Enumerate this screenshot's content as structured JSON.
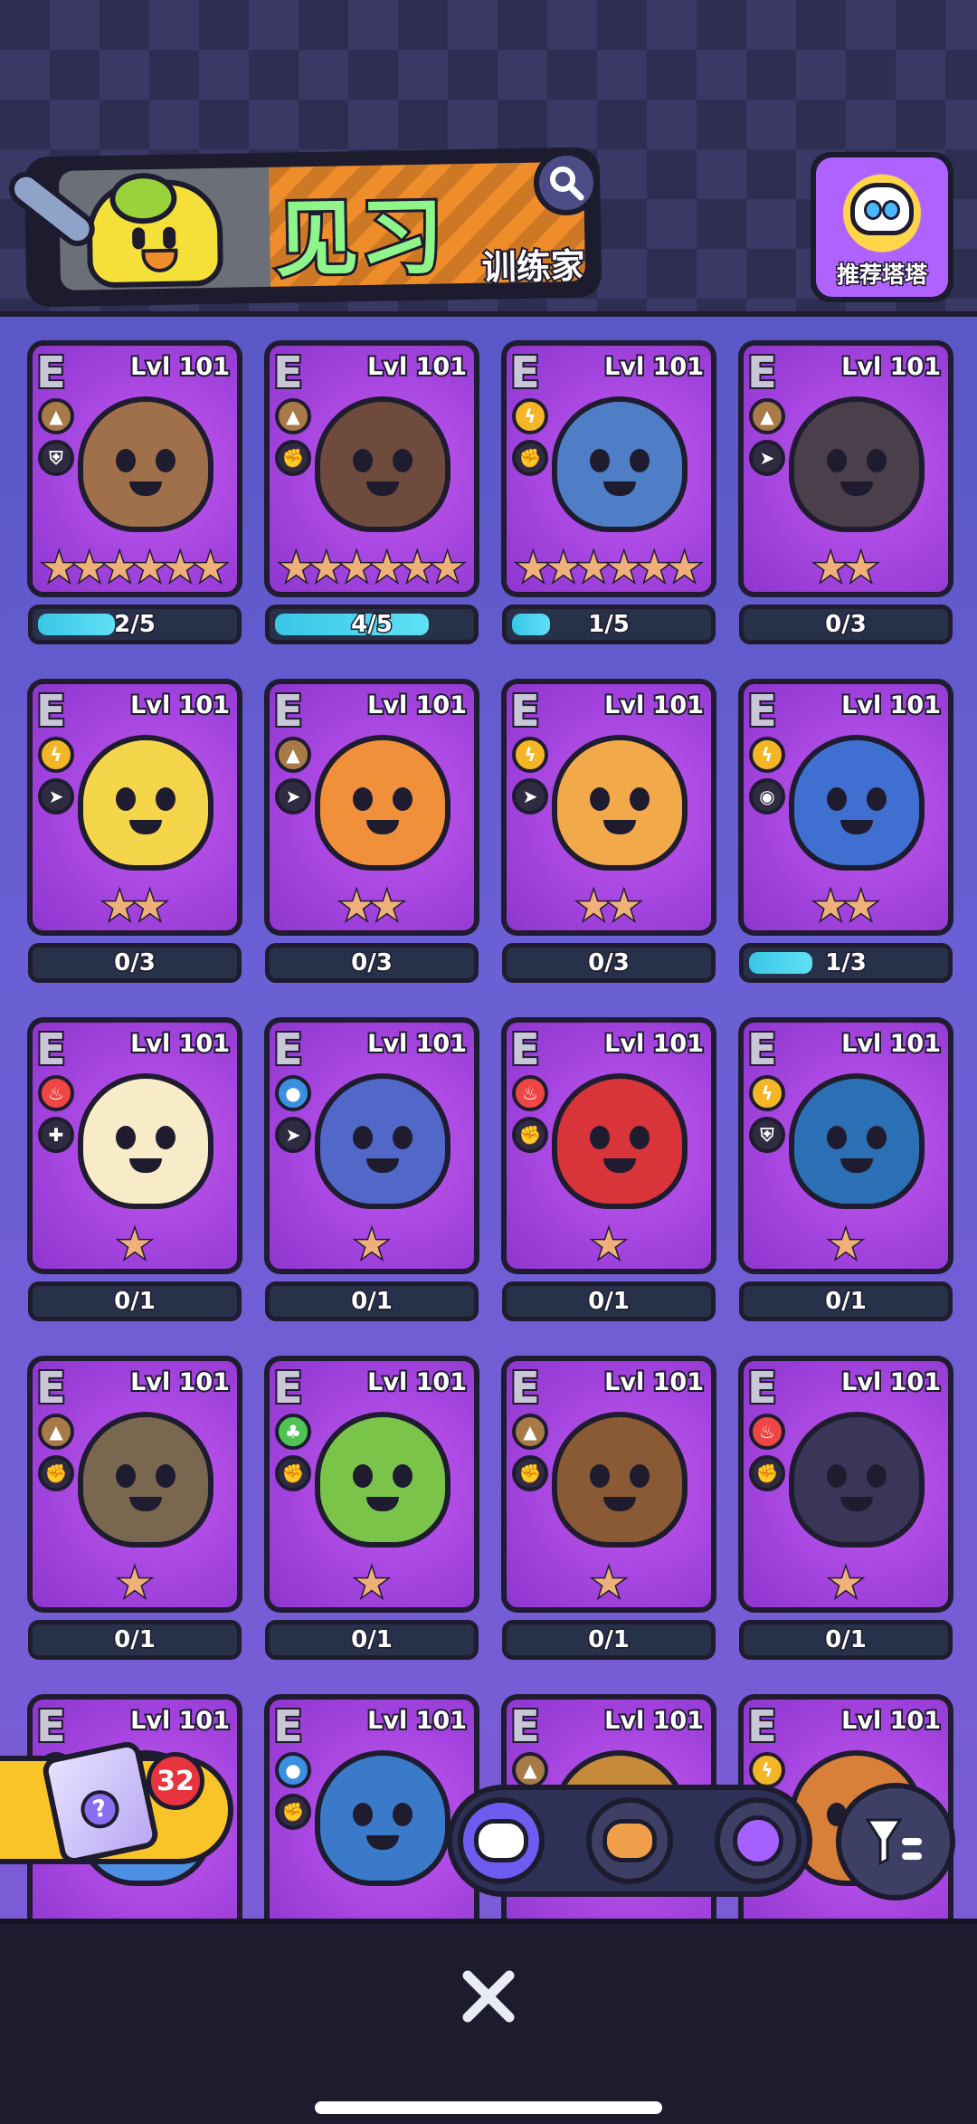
{
  "header": {
    "title": "见习",
    "subtitle": "训练家",
    "recommend_label": "推荐塔塔",
    "search_icon": "search-icon"
  },
  "cards": [
    {
      "rarity": "E",
      "level": "Lvl 101",
      "elem1": "earth",
      "elem2": "shield",
      "color": "#a0704a",
      "stars": 6,
      "progress_text": "2/5",
      "progress": 0.4
    },
    {
      "rarity": "E",
      "level": "Lvl 101",
      "elem1": "earth",
      "elem2": "fist",
      "color": "#6e4b3c",
      "stars": 6,
      "progress_text": "4/5",
      "progress": 0.8
    },
    {
      "rarity": "E",
      "level": "Lvl 101",
      "elem1": "thunder",
      "elem2": "fist",
      "color": "#4f7ec6",
      "stars": 6,
      "progress_text": "1/5",
      "progress": 0.2
    },
    {
      "rarity": "E",
      "level": "Lvl 101",
      "elem1": "earth",
      "elem2": "speed",
      "color": "#4a3f4a",
      "stars": 2,
      "progress_text": "0/3",
      "progress": 0
    },
    {
      "rarity": "E",
      "level": "Lvl 101",
      "elem1": "thunder",
      "elem2": "speed",
      "color": "#f5d64a",
      "stars": 2,
      "progress_text": "0/3",
      "progress": 0
    },
    {
      "rarity": "E",
      "level": "Lvl 101",
      "elem1": "earth",
      "elem2": "speed",
      "color": "#f0903a",
      "stars": 2,
      "progress_text": "0/3",
      "progress": 0
    },
    {
      "rarity": "E",
      "level": "Lvl 101",
      "elem1": "thunder",
      "elem2": "speed",
      "color": "#f2a94a",
      "stars": 2,
      "progress_text": "0/3",
      "progress": 0
    },
    {
      "rarity": "E",
      "level": "Lvl 101",
      "elem1": "thunder",
      "elem2": "eye",
      "color": "#3f6fd0",
      "stars": 2,
      "progress_text": "1/3",
      "progress": 0.33
    },
    {
      "rarity": "E",
      "level": "Lvl 101",
      "elem1": "fire",
      "elem2": "heal",
      "color": "#f7ebc8",
      "stars": 1,
      "progress_text": "0/1",
      "progress": 0
    },
    {
      "rarity": "E",
      "level": "Lvl 101",
      "elem1": "water",
      "elem2": "speed",
      "color": "#5168c9",
      "stars": 1,
      "progress_text": "0/1",
      "progress": 0
    },
    {
      "rarity": "E",
      "level": "Lvl 101",
      "elem1": "fire",
      "elem2": "fist",
      "color": "#d8343a",
      "stars": 1,
      "progress_text": "0/1",
      "progress": 0
    },
    {
      "rarity": "E",
      "level": "Lvl 101",
      "elem1": "thunder",
      "elem2": "shield",
      "color": "#2b6fb5",
      "stars": 1,
      "progress_text": "0/1",
      "progress": 0
    },
    {
      "rarity": "E",
      "level": "Lvl 101",
      "elem1": "earth",
      "elem2": "fist",
      "color": "#7a6750",
      "stars": 1,
      "progress_text": "0/1",
      "progress": 0
    },
    {
      "rarity": "E",
      "level": "Lvl 101",
      "elem1": "plant",
      "elem2": "fist",
      "color": "#7bc44a",
      "stars": 1,
      "progress_text": "0/1",
      "progress": 0
    },
    {
      "rarity": "E",
      "level": "Lvl 101",
      "elem1": "earth",
      "elem2": "fist",
      "color": "#8a5a34",
      "stars": 1,
      "progress_text": "0/1",
      "progress": 0
    },
    {
      "rarity": "E",
      "level": "Lvl 101",
      "elem1": "fire",
      "elem2": "fist",
      "color": "#3a3658",
      "stars": 1,
      "progress_text": "0/1",
      "progress": 0
    },
    {
      "rarity": "E",
      "level": "Lvl 101",
      "elem1": "water",
      "elem2": "",
      "color": "#4d8fe0",
      "stars": 0,
      "progress_text": "",
      "progress": 0
    },
    {
      "rarity": "E",
      "level": "Lvl 101",
      "elem1": "water",
      "elem2": "fist",
      "color": "#3a7ac8",
      "stars": 0,
      "progress_text": "",
      "progress": 0
    },
    {
      "rarity": "E",
      "level": "Lvl 101",
      "elem1": "earth",
      "elem2": "",
      "color": "#c58a3a",
      "stars": 0,
      "progress_text": "",
      "progress": 0
    },
    {
      "rarity": "E",
      "level": "Lvl 101",
      "elem1": "thunder",
      "elem2": "",
      "color": "#d8803a",
      "stars": 0,
      "progress_text": "",
      "progress": 0
    }
  ],
  "gift": {
    "count": "32",
    "icon": "mystery-box-icon"
  },
  "tabs": [
    {
      "name": "tab-robot",
      "icon": "robot-face-icon",
      "color": "#6e5cf0",
      "selected": true
    },
    {
      "name": "tab-hamster",
      "icon": "hamster-face-icon",
      "color": "#f0a04a",
      "selected": false
    },
    {
      "name": "tab-cat-badge",
      "icon": "cat-badge-icon",
      "color": "#a660ff",
      "selected": false
    }
  ],
  "filter_icon": "filter-icon",
  "close_icon": "close-icon"
}
